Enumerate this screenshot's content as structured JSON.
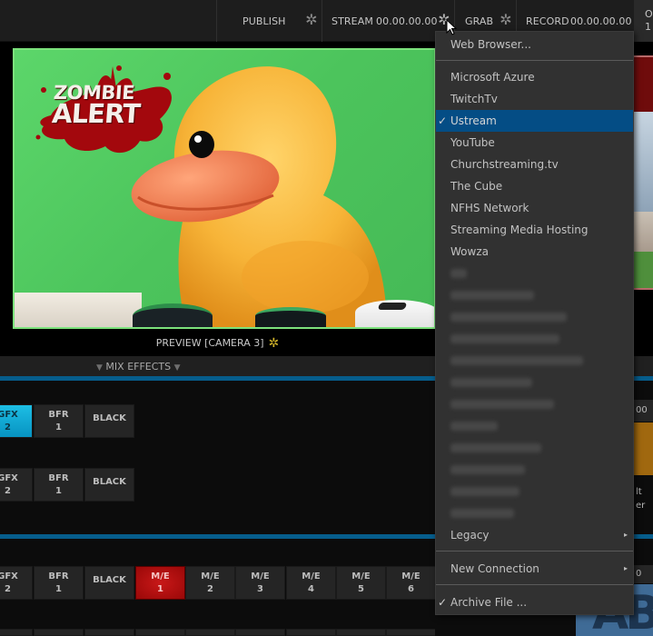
{
  "topbar": {
    "publish_label": "PUBLISH",
    "stream_label": "STREAM",
    "stream_time": "00.00.00.00",
    "grab_label": "GRAB",
    "record_label": "RECORD",
    "record_time": "00.00.00.00",
    "right_cut_label_1": "O",
    "right_cut_label_2": "1",
    "icons": {
      "publish_settings": "gear-icon",
      "stream_settings": "gear-icon",
      "grab_settings": "gear-icon"
    }
  },
  "preview": {
    "label": "PREVIEW [CAMERA 3]",
    "overlay_line1": "ZOMBIE",
    "overlay_line2": "ALERT",
    "settings_icon": "gear-icon",
    "settings_color": "#d2b42a",
    "border_color": "#7ce27c"
  },
  "mix_effects": {
    "label": "MIX EFFECTS",
    "accent": "#065d8c"
  },
  "switcher": {
    "row1": [
      {
        "top": "GFX",
        "bottom": "2",
        "state": "active-cyan"
      },
      {
        "top": "BFR",
        "bottom": "1",
        "state": "normal"
      },
      {
        "top": "BLACK",
        "bottom": "",
        "state": "normal"
      }
    ],
    "row2": [
      {
        "top": "GFX",
        "bottom": "2",
        "state": "normal"
      },
      {
        "top": "BFR",
        "bottom": "1",
        "state": "normal"
      },
      {
        "top": "BLACK",
        "bottom": "",
        "state": "normal"
      }
    ],
    "row3": [
      {
        "top": "GFX",
        "bottom": "2",
        "state": "normal"
      },
      {
        "top": "BFR",
        "bottom": "1",
        "state": "normal"
      },
      {
        "top": "BLACK",
        "bottom": "",
        "state": "normal"
      },
      {
        "top": "M/E",
        "bottom": "1",
        "state": "active-red"
      },
      {
        "top": "M/E",
        "bottom": "2",
        "state": "normal"
      },
      {
        "top": "M/E",
        "bottom": "3",
        "state": "normal"
      },
      {
        "top": "M/E",
        "bottom": "4",
        "state": "normal"
      },
      {
        "top": "M/E",
        "bottom": "5",
        "state": "normal"
      },
      {
        "top": "M/E",
        "bottom": "6",
        "state": "normal"
      }
    ],
    "colors": {
      "active_cyan": "#1dbee4",
      "active_red": "#b51010"
    }
  },
  "right_partial": {
    "value_label": "00",
    "text_line1": "lt",
    "text_line2": "er",
    "bottom_label": "0",
    "ab_label": "AB"
  },
  "stream_menu": {
    "web_browser": "Web Browser...",
    "providers": [
      {
        "label": "Microsoft Azure",
        "checked": false
      },
      {
        "label": "TwitchTv",
        "checked": false
      },
      {
        "label": "Ustream",
        "checked": true
      },
      {
        "label": "YouTube",
        "checked": false
      },
      {
        "label": "Churchstreaming.tv",
        "checked": false
      },
      {
        "label": "The Cube",
        "checked": false
      },
      {
        "label": "NFHS Network",
        "checked": false
      },
      {
        "label": "Streaming Media Hosting",
        "checked": false
      },
      {
        "label": "Wowza",
        "checked": false
      }
    ],
    "redacted_item_count": 12,
    "legacy": "Legacy",
    "new_connection": "New Connection",
    "archive_file": "Archive File ...",
    "archive_checked": true,
    "check_glyph": "✓",
    "submenu_arrow": "▸",
    "selected_color": "#044d85"
  }
}
